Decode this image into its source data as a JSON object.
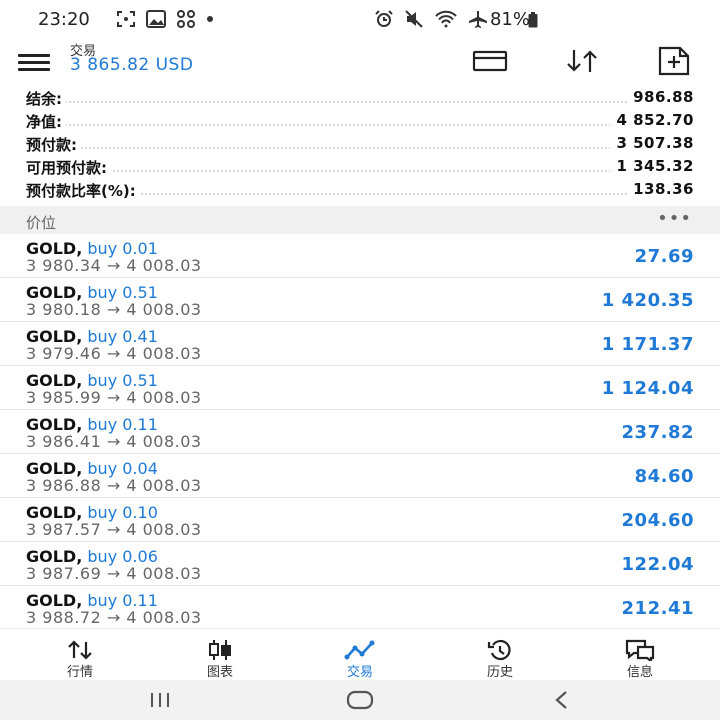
{
  "status_bar": {
    "time": "23:20",
    "battery": "81%",
    "icons_left": [
      "screenshot-icon",
      "gallery-icon",
      "apps-icon",
      "dot-icon"
    ],
    "icons_right": [
      "alarm-icon",
      "mute-icon",
      "wifi-icon",
      "airplane-icon",
      "battery-icon"
    ]
  },
  "header": {
    "title": "交易",
    "balance": "3 865.82 USD",
    "actions": [
      "card-icon",
      "sort-icon",
      "new-order-icon"
    ]
  },
  "summary": [
    {
      "label": "结余:",
      "value": "986.88"
    },
    {
      "label": "净值:",
      "value": "4 852.70"
    },
    {
      "label": "预付款:",
      "value": "3 507.38"
    },
    {
      "label": "可用预付款:",
      "value": "1 345.32"
    },
    {
      "label": "预付款比率(%):",
      "value": "138.36"
    }
  ],
  "section": {
    "title": "价位",
    "more": "•••"
  },
  "positions": [
    {
      "symbol": "GOLD,",
      "dir": "buy 0.01",
      "prices": "3 980.34 → 4 008.03",
      "profit": "27.69"
    },
    {
      "symbol": "GOLD,",
      "dir": "buy 0.51",
      "prices": "3 980.18 → 4 008.03",
      "profit": "1 420.35"
    },
    {
      "symbol": "GOLD,",
      "dir": "buy 0.41",
      "prices": "3 979.46 → 4 008.03",
      "profit": "1 171.37"
    },
    {
      "symbol": "GOLD,",
      "dir": "buy 0.51",
      "prices": "3 985.99 → 4 008.03",
      "profit": "1 124.04"
    },
    {
      "symbol": "GOLD,",
      "dir": "buy 0.11",
      "prices": "3 986.41 → 4 008.03",
      "profit": "237.82"
    },
    {
      "symbol": "GOLD,",
      "dir": "buy 0.04",
      "prices": "3 986.88 → 4 008.03",
      "profit": "84.60"
    },
    {
      "symbol": "GOLD,",
      "dir": "buy 0.10",
      "prices": "3 987.57 → 4 008.03",
      "profit": "204.60"
    },
    {
      "symbol": "GOLD,",
      "dir": "buy 0.06",
      "prices": "3 987.69 → 4 008.03",
      "profit": "122.04"
    },
    {
      "symbol": "GOLD,",
      "dir": "buy 0.11",
      "prices": "3 988.72 → 4 008.03",
      "profit": "212.41"
    }
  ],
  "bottom_nav": [
    {
      "label": "行情",
      "icon": "quotes-icon"
    },
    {
      "label": "图表",
      "icon": "chart-icon"
    },
    {
      "label": "交易",
      "icon": "trade-icon",
      "active": true
    },
    {
      "label": "历史",
      "icon": "history-icon"
    },
    {
      "label": "信息",
      "icon": "messages-icon"
    }
  ],
  "colors": {
    "accent": "#1e7ad6",
    "text": "#111111",
    "muted": "#666666"
  }
}
